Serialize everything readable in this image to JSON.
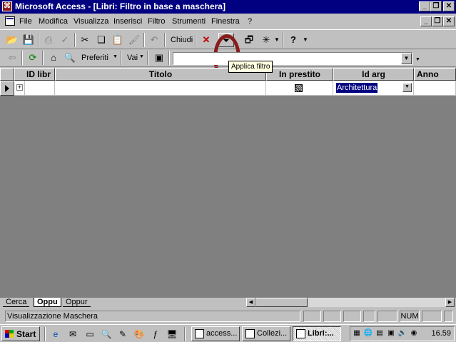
{
  "window": {
    "title": "Microsoft Access - [Libri: Filtro in base a maschera]",
    "app_icon": "access-key-icon",
    "controls": [
      "minimize-icon",
      "restore-icon",
      "close-icon"
    ]
  },
  "menu": {
    "items": [
      "File",
      "Modifica",
      "Visualizza",
      "Inserisci",
      "Filtro",
      "Strumenti",
      "Finestra",
      "?"
    ]
  },
  "toolbar1": {
    "close_label": "Chiudi",
    "filter_tooltip": "Applica filtro",
    "buttons": [
      "open-folder-icon",
      "save-icon",
      "print-icon",
      "spellcheck-icon",
      "cut-icon",
      "copy-icon",
      "paste-icon",
      "format-painter-icon",
      "undo-icon",
      "clear-grid-icon",
      "filter-icon",
      "window-icon",
      "new-object-icon",
      "help-icon"
    ],
    "highlight_color": "#8a1b1b"
  },
  "toolbar2": {
    "favorites_label": "Preferiti",
    "go_label": "Vai",
    "address_value": "",
    "buttons": [
      "back-arrow-icon",
      "refresh-icon",
      "home-icon",
      "search-web-icon",
      "show-only-web-toolbar-icon"
    ]
  },
  "datasheet": {
    "columns": [
      "ID libr",
      "Titolo",
      "In prestito",
      "Id arg",
      "Anno"
    ],
    "row": {
      "id": "",
      "titolo": "",
      "in_prestito": "grayed",
      "id_arg": "Architettura",
      "anno": ""
    },
    "selection_color": "#000080",
    "background": "#808080"
  },
  "tabs": {
    "items": [
      "Cerca",
      "Oppu",
      "Oppur"
    ],
    "active": "Oppu"
  },
  "statusbar": {
    "text": "Visualizzazione Maschera",
    "num_label": "NUM"
  },
  "taskbar": {
    "start_label": "Start",
    "tasks": [
      "access...",
      "Collezi...",
      "Libri:..."
    ],
    "active_task": "Libri:...",
    "clock": "16.59"
  }
}
